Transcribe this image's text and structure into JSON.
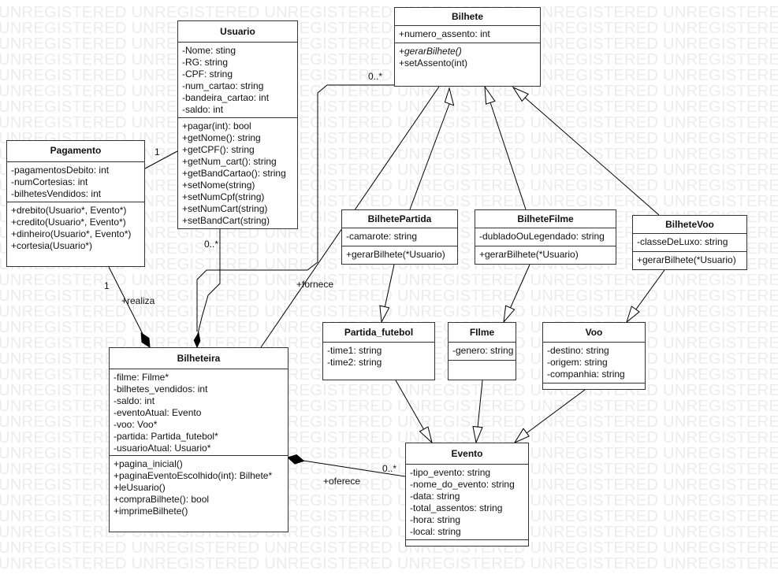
{
  "watermark": "UNREGISTERED",
  "classes": {
    "bilhete": {
      "name": "Bilhete",
      "attributes": [
        "+numero_assento: int"
      ],
      "methods": [
        "+gerarBilhete()",
        "+setAssento(int)"
      ]
    },
    "usuario": {
      "name": "Usuario",
      "attributes": [
        "-Nome: sting",
        "-RG: string",
        "-CPF: string",
        "-num_cartao: string",
        "-bandeira_cartao: int",
        "-saldo: int"
      ],
      "methods": [
        "+pagar(int): bool",
        "+getNome(): string",
        "+getCPF(): string",
        "+getNum_cart(): string",
        "+getBandCartao(): string",
        "+setNome(string)",
        "+setNumCpf(string)",
        "+setNumCart(string)",
        "+setBandCart(string)"
      ]
    },
    "pagamento": {
      "name": "Pagamento",
      "attributes": [
        "-pagamentosDebito: int",
        "-numCortesias: int",
        "-bilhetesVendidos: int"
      ],
      "methods": [
        "+drebito(Usuario*, Evento*)",
        "+credito(Usuario*, Evento*)",
        "+dinheiro(Usuario*, Evento*)",
        "+cortesia(Usuario*)"
      ]
    },
    "bilhetepartida": {
      "name": "BilhetePartida",
      "attributes": [
        "-camarote: string"
      ],
      "methods": [
        "+gerarBilhete(*Usuario)"
      ]
    },
    "bilhetefilme": {
      "name": "BilheteFilme",
      "attributes": [
        "-dubladoOuLegendado: string"
      ],
      "methods": [
        "+gerarBilhete(*Usuario)"
      ]
    },
    "bilhetevoo": {
      "name": "BilheteVoo",
      "attributes": [
        "-classeDeLuxo: string"
      ],
      "methods": [
        "+gerarBilhete(*Usuario)"
      ]
    },
    "partida": {
      "name": "Partida_futebol",
      "attributes": [
        "-time1: string",
        "-time2: string"
      ],
      "methods": []
    },
    "filme": {
      "name": "FIlme",
      "attributes": [
        "-genero: string"
      ],
      "methods": []
    },
    "voo": {
      "name": "Voo",
      "attributes": [
        "-destino: string",
        "-origem: string",
        "-companhia: string"
      ],
      "methods": []
    },
    "bilheteira": {
      "name": "Bilheteira",
      "attributes": [
        "-filme: Filme*",
        "-bilhetes_vendidos: int",
        "-saldo: int",
        "-eventoAtual: Evento",
        "-voo: Voo*",
        "-partida: Partida_futebol*",
        "-usuarioAtual: Usuario*"
      ],
      "methods": [
        "+pagina_inicial()",
        "+paginaEventoEscolhido(int): Bilhete*",
        "+leUsuario()",
        "+compraBilhete(): bool",
        "+imprimeBilhete()"
      ]
    },
    "evento": {
      "name": "Evento",
      "attributes": [
        "-tipo_evento: string",
        "-nome_do_evento: string",
        "-data: string",
        "-total_assentos: string",
        "-hora: string",
        "-local: string"
      ],
      "methods": []
    }
  },
  "labels": {
    "fornece": "+fornece",
    "realiza": "+realiza",
    "oferece": "+oferece",
    "mult_pag_usuario": "1",
    "mult_pag_bilheteira": "1",
    "mult_usuario_bilheteira": "0..*",
    "mult_bilhete": "0..*",
    "mult_evento": "0..*"
  },
  "abstract_methods": [
    "+gerarBilhete()"
  ]
}
